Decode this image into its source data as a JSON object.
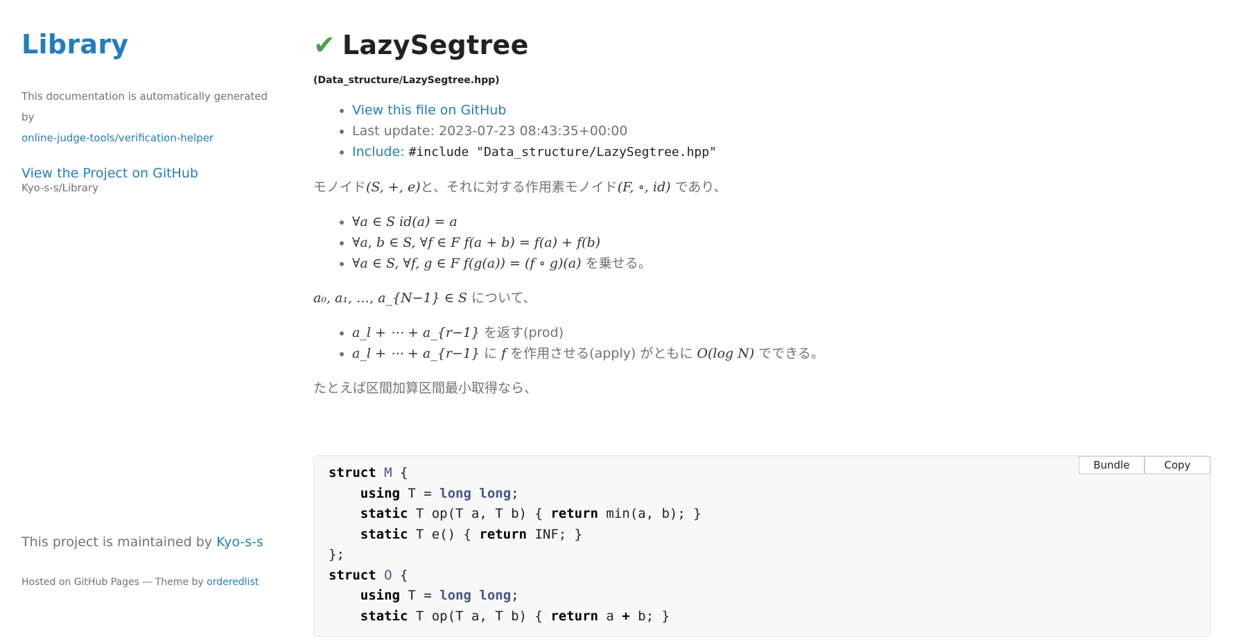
{
  "sidebar": {
    "title": "Library",
    "auto_text": "This documentation is automatically generated by",
    "helper_link": "online-judge-tools/verification-helper",
    "gh_link": "View the Project on GitHub",
    "gh_sub": "Kyo-s-s/Library",
    "maintained_text": "This project is maintained by ",
    "maintainer": "Kyo-s-s",
    "hosted_text": "Hosted on GitHub Pages — Theme by ",
    "theme_link": "orderedlist"
  },
  "page": {
    "check_icon": "✔",
    "title": "LazySegtree",
    "path": "(Data_structure/LazySegtree.hpp)",
    "info": {
      "view_file": "View this file on GitHub",
      "last_update_label": "Last update: ",
      "last_update": "2023-07-23 08:43:35+00:00",
      "include_label": "Include:",
      "include_code": "#include \"Data_structure/LazySegtree.hpp\""
    },
    "desc": {
      "p1_a": "モノイド",
      "p1_m1": "(S, +, e)",
      "p1_b": "と、それに対する作用素モノイド",
      "p1_m2": "(F, ∘, id)",
      "p1_c": " であり、",
      "b1": "∀a ∈ S  id(a) = a",
      "b2": "∀a, b ∈ S, ∀f ∈ F  f(a + b) = f(a) + f(b)",
      "b3_m": "∀a ∈ S, ∀f, g ∈ F  f(g(a)) = (f ∘ g)(a)",
      "b3_t": " を乗せる。",
      "p2_m": "a₀, a₁, …, a_{N−1} ∈ S",
      "p2_t": " について、",
      "c1_m": "a_l + ⋯ + a_{r−1}",
      "c1_t": " を返す(prod)",
      "c2_m": "a_l + ⋯ + a_{r−1}",
      "c2_t1": " に ",
      "c2_f": "f",
      "c2_t2": " を作用させる(apply) がともに ",
      "c2_o": "O(log N)",
      "c2_t3": " でできる。",
      "p3": "たとえば区間加算区間最小取得なら、"
    },
    "code_buttons": {
      "bundle": "Bundle",
      "copy": "Copy"
    }
  }
}
